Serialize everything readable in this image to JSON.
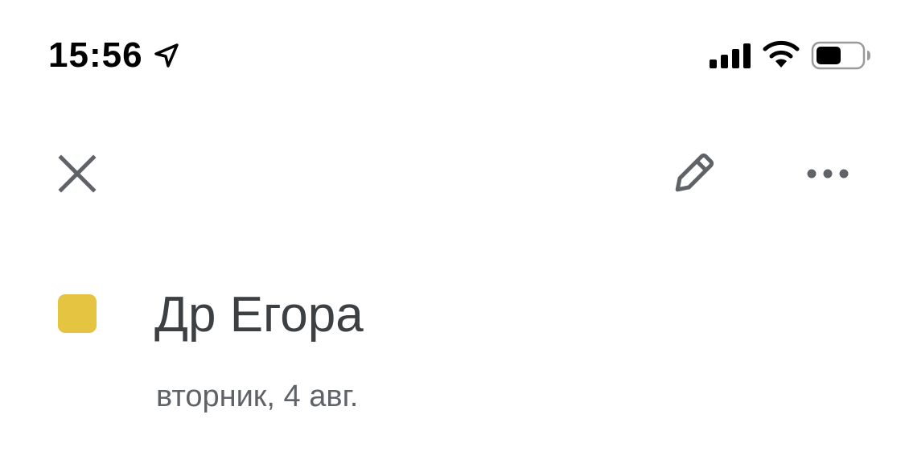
{
  "status_bar": {
    "time": "15:56",
    "icons": [
      "location-arrow-icon",
      "cellular-signal-icon",
      "wifi-icon",
      "battery-icon"
    ]
  },
  "toolbar": {
    "icons": [
      "close-icon",
      "pencil-edit-icon",
      "more-horizontal-icon"
    ]
  },
  "event": {
    "title": "Др Егора",
    "date": "вторник, 4 авг.",
    "color": "#E4C441"
  },
  "colors": {
    "title_text": "#3C4043",
    "secondary_text": "#5F6368",
    "icon": "#5F6368"
  }
}
